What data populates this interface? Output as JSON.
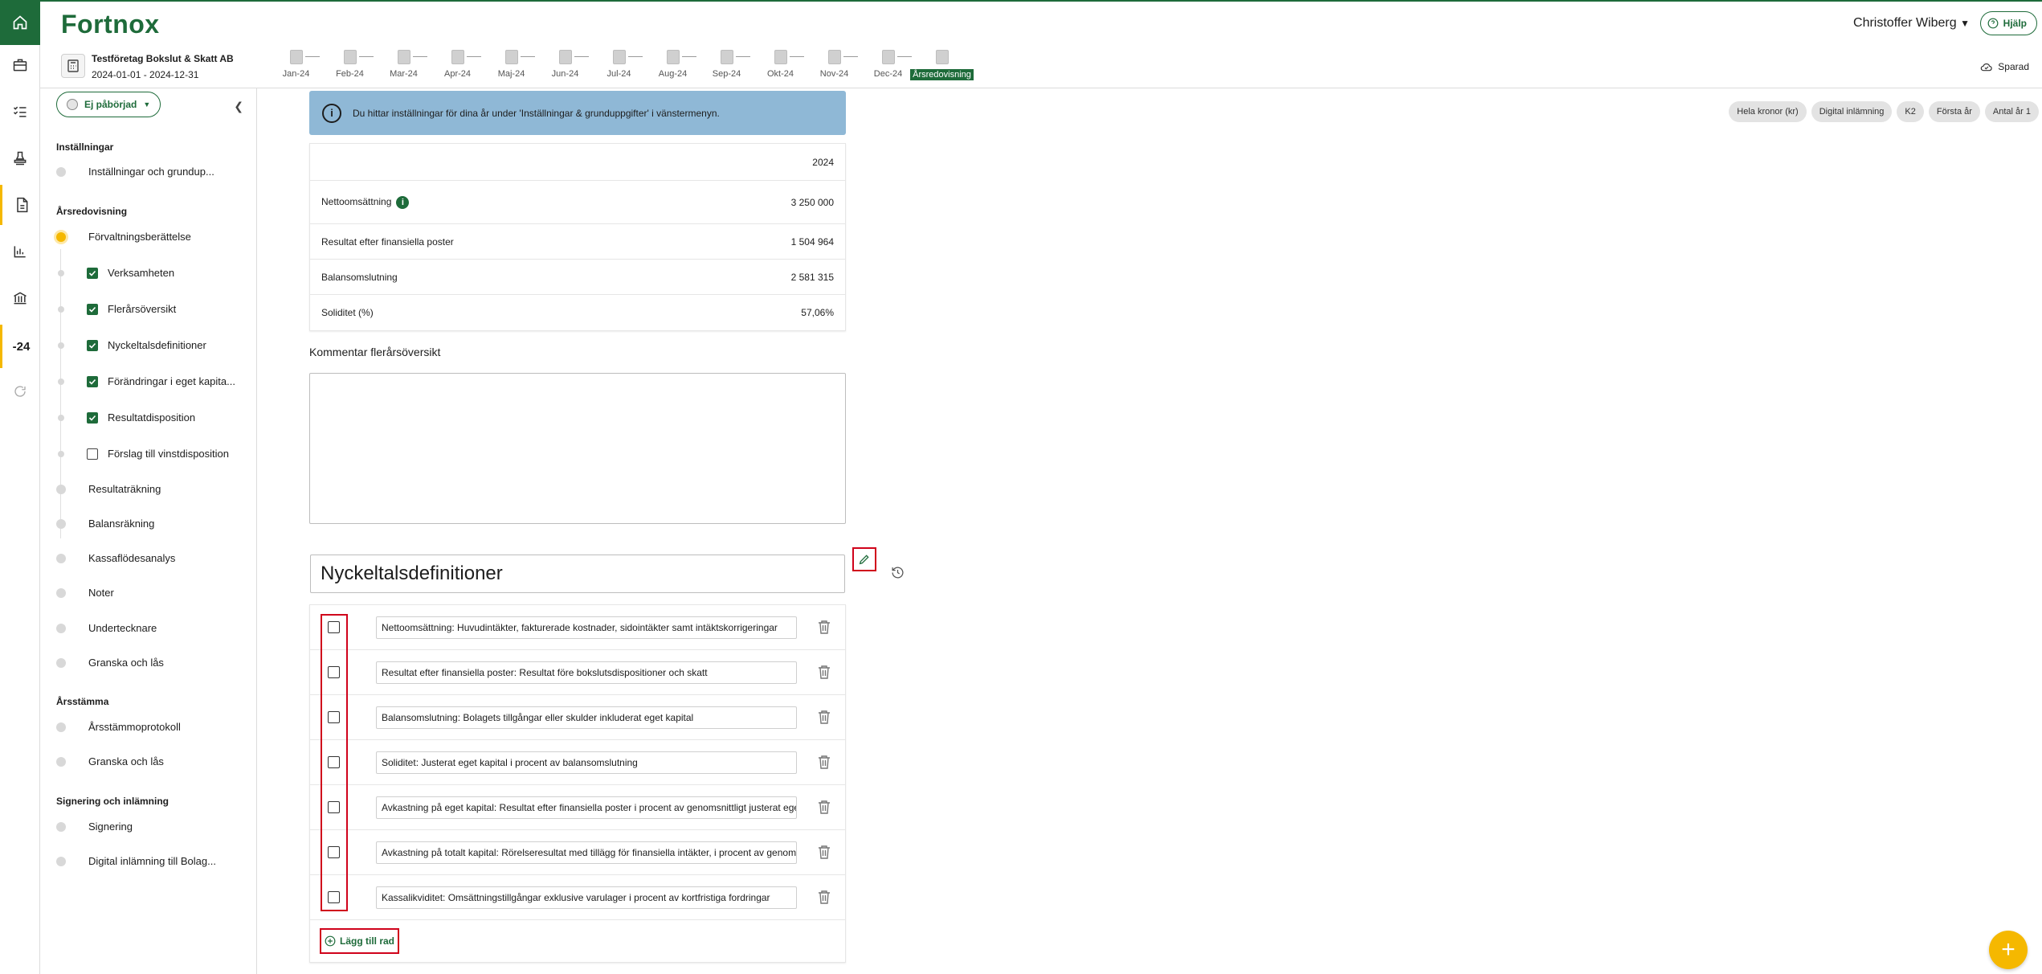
{
  "header": {
    "logo": "Fortnox",
    "user_name": "Christoffer Wiberg",
    "help_label": "Hjälp",
    "saved_label": "Sparad"
  },
  "company": {
    "name": "Testföretag Bokslut & Skatt AB",
    "period": "2024-01-01 - 2024-12-31"
  },
  "timeline": [
    "Jan-24",
    "Feb-24",
    "Mar-24",
    "Apr-24",
    "Maj-24",
    "Jun-24",
    "Jul-24",
    "Aug-24",
    "Sep-24",
    "Okt-24",
    "Nov-24",
    "Dec-24",
    "Årsredovisning"
  ],
  "rail": {
    "year_label": "-24"
  },
  "nav": {
    "status_label": "Ej påbörjad",
    "sections": {
      "installningar": "Inställningar",
      "arsredovisning": "Årsredovisning",
      "arsstamma": "Årsstämma",
      "signering": "Signering och inlämning"
    },
    "items": {
      "installningar_grund": "Inställningar och grundup...",
      "forvaltning": "Förvaltningsberättelse",
      "verksamheten": "Verksamheten",
      "flerars": "Flerårsöversikt",
      "nyckeltal": "Nyckeltalsdefinitioner",
      "forandringar": "Förändringar i eget kapita...",
      "resultatdisp": "Resultatdisposition",
      "forslag": "Förslag till vinstdisposition",
      "resultatrakning": "Resultaträkning",
      "balansrakning": "Balansräkning",
      "kassaflode": "Kassaflödesanalys",
      "noter": "Noter",
      "underteckn": "Undertecknare",
      "granska1": "Granska och lås",
      "protokoll": "Årsstämmoprotokoll",
      "granska2": "Granska och lås",
      "signering": "Signering",
      "digital": "Digital inlämning till Bolag..."
    }
  },
  "info_banner": "Du hittar inställningar för dina år under 'Inställningar & grunduppgifter' i vänstermenyn.",
  "chips": [
    "Hela kronor (kr)",
    "Digital inlämning",
    "K2",
    "Första år",
    "Antal år 1"
  ],
  "key_figures": {
    "year": "2024",
    "rows": [
      {
        "label": "Nettoomsättning",
        "value": "3 250 000"
      },
      {
        "label": "Resultat efter finansiella poster",
        "value": "1 504 964"
      },
      {
        "label": "Balansomslutning",
        "value": "2 581 315"
      },
      {
        "label": "Soliditet (%)",
        "value": "57,06%"
      }
    ]
  },
  "comment_label": "Kommentar flerårsöversikt",
  "definitions": {
    "title": "Nyckeltalsdefinitioner",
    "rows": [
      "Nettoomsättning: Huvudintäkter, fakturerade kostnader, sidointäkter samt intäktskorrigeringar",
      "Resultat efter finansiella poster: Resultat före bokslutsdispositioner och skatt",
      "Balansomslutning: Bolagets tillgångar eller skulder inkluderat eget kapital",
      "Soliditet: Justerat eget kapital i procent av balansomslutning",
      "Avkastning på eget kapital: Resultat efter finansiella poster i procent av genomsnittligt justerat eget kapital",
      "Avkastning på totalt kapital: Rörelseresultat med tillägg för finansiella intäkter, i procent av genomsnittlig balansomslutning",
      "Kassalikviditet: Omsättningstillgångar exklusive varulager i procent av kortfristiga fordringar"
    ],
    "add_row_label": "Lägg till rad"
  },
  "colors": {
    "brand": "#1e6b3a",
    "accent": "#f5b800",
    "highlight": "#d0021b",
    "banner": "#8fb8d6"
  }
}
